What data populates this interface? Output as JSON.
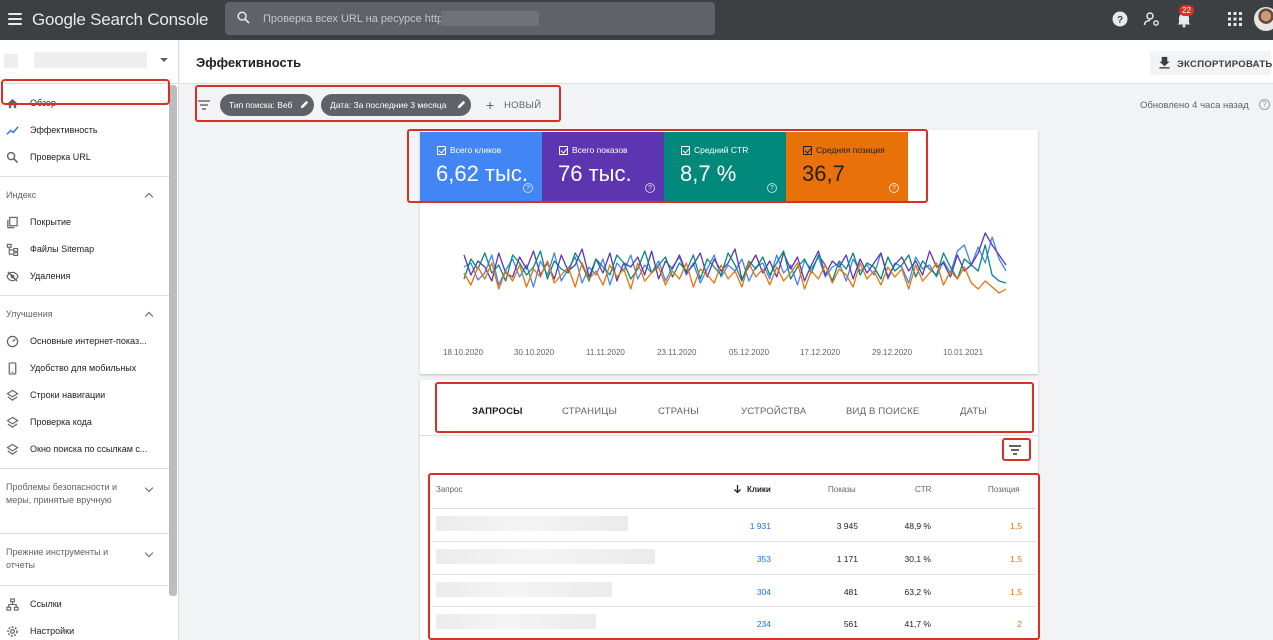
{
  "app": {
    "title": "Google Search Console",
    "search_placeholder": "Проверка всех URL на ресурсе http://",
    "notification_count": "22"
  },
  "sidebar": {
    "items_top": [
      {
        "label": "Обзор",
        "icon": "home-icon"
      },
      {
        "label": "Эффективность",
        "icon": "trending-icon",
        "active": true
      },
      {
        "label": "Проверка URL",
        "icon": "search-icon"
      }
    ],
    "sections": [
      {
        "title": "Индекс",
        "expanded": true,
        "items": [
          {
            "label": "Покрытие",
            "icon": "file-copy-icon"
          },
          {
            "label": "Файлы Sitemap",
            "icon": "sitemap-icon"
          },
          {
            "label": "Удаления",
            "icon": "visibility-off-icon"
          }
        ]
      },
      {
        "title": "Улучшения",
        "expanded": true,
        "items": [
          {
            "label": "Основные интернет-показ...",
            "icon": "gauge-icon"
          },
          {
            "label": "Удобство для мобильных",
            "icon": "smartphone-icon"
          },
          {
            "label": "Строки навигации",
            "icon": "layers-icon"
          },
          {
            "label": "Проверка кода",
            "icon": "layers-icon"
          },
          {
            "label": "Окно поиска по ссылкам с...",
            "icon": "layers-icon"
          }
        ]
      },
      {
        "title": "Проблемы безопасности и меры, принятые вручную",
        "expanded": false
      },
      {
        "title": "Прежние инструменты и отчеты",
        "expanded": false
      }
    ],
    "items_bottom": [
      {
        "label": "Ссылки",
        "icon": "links-icon"
      },
      {
        "label": "Настройки",
        "icon": "settings-icon"
      }
    ]
  },
  "header": {
    "page_title": "Эффективность",
    "export_label": "ЭКСПОРТИРОВАТЬ"
  },
  "filters": {
    "chips": [
      {
        "label": "Тип поиска: Веб"
      },
      {
        "label": "Дата: За последние 3 месяца"
      }
    ],
    "new_label": "НОВЫЙ",
    "updated_text": "Обновлено 4 часа назад"
  },
  "metrics": [
    {
      "label": "Всего кликов",
      "value": "6,62 тыс.",
      "color": "#4285f4",
      "checked": true
    },
    {
      "label": "Всего показов",
      "value": "76 тыс.",
      "color": "#5e35b1",
      "checked": true
    },
    {
      "label": "Средний CTR",
      "value": "8,7 %",
      "color": "#00897b",
      "checked": true
    },
    {
      "label": "Средняя позиция",
      "value": "36,7",
      "color": "#e8710a",
      "checked": true
    }
  ],
  "chart_data": {
    "type": "line",
    "x_ticks": [
      "18.10.2020",
      "30.10.2020",
      "11.11.2020",
      "23.11.2020",
      "05.12.2020",
      "17.12.2020",
      "29.12.2020",
      "10.01.2021"
    ],
    "ylim": [
      0,
      100
    ],
    "grid": false,
    "series": [
      {
        "name": "Всего кликов",
        "color": "#4285f4",
        "values": [
          58,
          62,
          45,
          52,
          70,
          40,
          55,
          66,
          48,
          60,
          38,
          64,
          50,
          72,
          44,
          56,
          68,
          42,
          58,
          50,
          66,
          40,
          62,
          54,
          70,
          46,
          60,
          52,
          64,
          44,
          58,
          68,
          50,
          62,
          42,
          56,
          70,
          48,
          60,
          54,
          66,
          44,
          58,
          62,
          46,
          70,
          52,
          60,
          40,
          64,
          56,
          68,
          48,
          58,
          62,
          44,
          66,
          54,
          60,
          50,
          72,
          46,
          62,
          58,
          42,
          68,
          56,
          60,
          48,
          64,
          52,
          74,
          80,
          60,
          78,
          62,
          88,
          66,
          54
        ]
      },
      {
        "name": "Всего показов",
        "color": "#5e35b1",
        "values": [
          70,
          50,
          64,
          58,
          44,
          72,
          52,
          48,
          68,
          56,
          74,
          50,
          62,
          46,
          70,
          54,
          60,
          76,
          48,
          66,
          52,
          72,
          44,
          62,
          58,
          68,
          50,
          74,
          46,
          64,
          56,
          70,
          52,
          60,
          72,
          48,
          66,
          54,
          62,
          76,
          46,
          58,
          70,
          52,
          64,
          48,
          72,
          56,
          68,
          44,
          60,
          74,
          50,
          64,
          58,
          70,
          46,
          66,
          52,
          62,
          72,
          48,
          60,
          68,
          54,
          64,
          50,
          74,
          58,
          62,
          48,
          70,
          54,
          60,
          72,
          92,
          80,
          70,
          60
        ]
      },
      {
        "name": "Средний CTR",
        "color": "#00897b",
        "values": [
          46,
          66,
          56,
          72,
          52,
          60,
          44,
          70,
          62,
          50,
          58,
          74,
          46,
          64,
          56,
          52,
          72,
          60,
          44,
          66,
          58,
          50,
          70,
          62,
          46,
          56,
          74,
          52,
          60,
          68,
          48,
          62,
          54,
          70,
          46,
          66,
          58,
          50,
          72,
          60,
          44,
          64,
          56,
          68,
          50,
          62,
          74,
          46,
          58,
          66,
          52,
          70,
          60,
          44,
          64,
          56,
          72,
          50,
          62,
          58,
          46,
          68,
          54,
          60,
          70,
          48,
          64,
          56,
          50,
          72,
          58,
          46,
          66,
          60,
          54,
          80,
          50,
          44,
          42
        ]
      },
      {
        "name": "Средняя позиция",
        "color": "#e8710a",
        "values": [
          52,
          40,
          58,
          46,
          62,
          36,
          54,
          44,
          60,
          38,
          56,
          48,
          64,
          42,
          50,
          58,
          38,
          62,
          46,
          54,
          40,
          60,
          48,
          56,
          36,
          62,
          44,
          52,
          58,
          40,
          54,
          46,
          62,
          38,
          56,
          50,
          42,
          60,
          46,
          54,
          38,
          62,
          48,
          56,
          40,
          58,
          44,
          52,
          62,
          36,
          54,
          46,
          60,
          42,
          56,
          50,
          38,
          62,
          46,
          54,
          40,
          58,
          48,
          56,
          36,
          60,
          44,
          52,
          62,
          40,
          54,
          46,
          58,
          42,
          36,
          44,
          38,
          32,
          36
        ]
      }
    ]
  },
  "tabs": [
    {
      "label": "ЗАПРОСЫ",
      "active": true
    },
    {
      "label": "СТРАНИЦЫ"
    },
    {
      "label": "СТРАНЫ"
    },
    {
      "label": "УСТРОЙСТВА"
    },
    {
      "label": "ВИД В ПОИСКЕ"
    },
    {
      "label": "ДАТЫ"
    }
  ],
  "table": {
    "columns": [
      "Запрос",
      "Клики",
      "Показы",
      "CTR",
      "Позиция"
    ],
    "sorted_column": "Клики",
    "rows": [
      {
        "clicks": "1 931",
        "impressions": "3 945",
        "ctr": "48,9 %",
        "position": "1,5"
      },
      {
        "clicks": "353",
        "impressions": "1 171",
        "ctr": "30,1 %",
        "position": "1,5"
      },
      {
        "clicks": "304",
        "impressions": "481",
        "ctr": "63,2 %",
        "position": "1,5"
      },
      {
        "clicks": "234",
        "impressions": "561",
        "ctr": "41,7 %",
        "position": "2"
      }
    ]
  }
}
